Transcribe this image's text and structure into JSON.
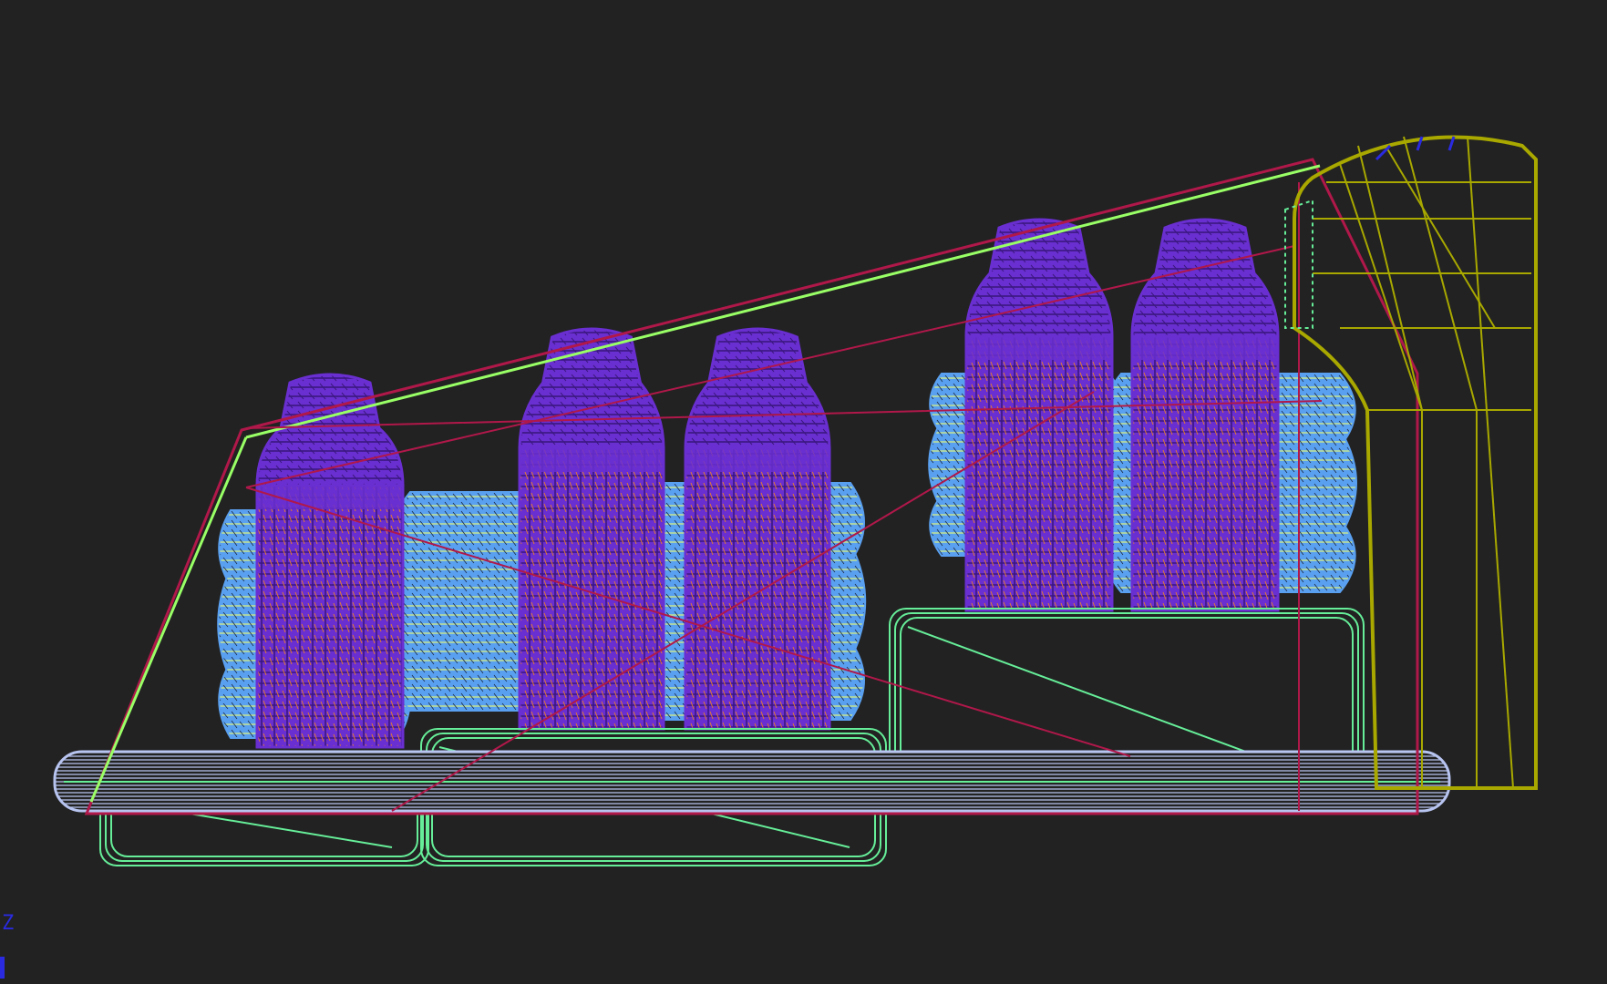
{
  "viewport": {
    "background": "#222222",
    "view_axis_label": "Z",
    "colors": {
      "bottle": "#6a2fd0",
      "bottle_dark": "#3b1780",
      "bottle_detail": "#e07a30",
      "cushion": "#5aa0f0",
      "cushion_detail": "#d8f080",
      "tray": "#66ee99",
      "bag": "#b0184a",
      "bag_hi": "#99ff66",
      "rail": "#b8c4f0",
      "handle": "#a8a800",
      "axis": "#2a2ae0"
    }
  }
}
